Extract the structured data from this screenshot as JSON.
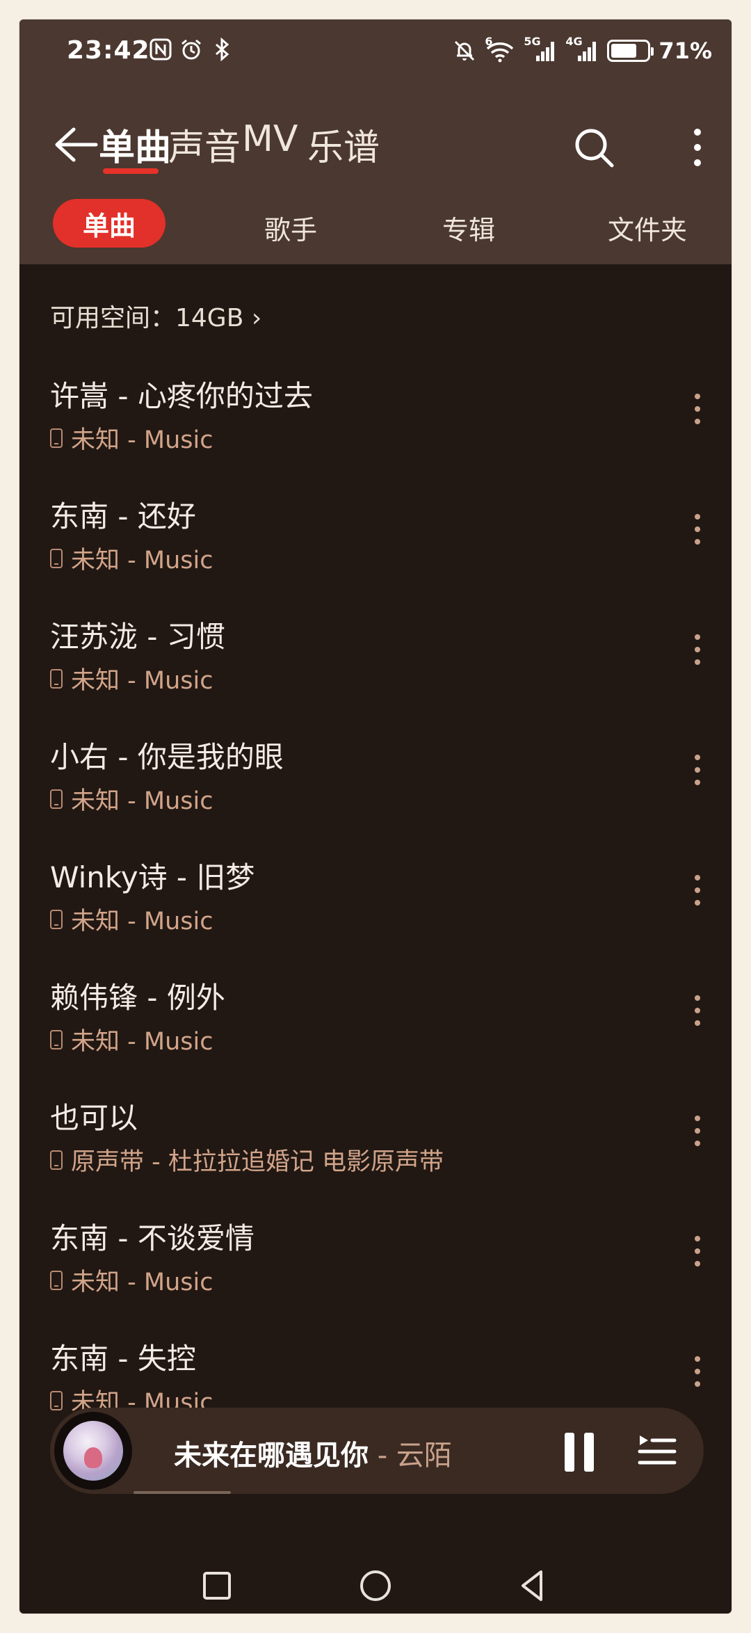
{
  "status_bar": {
    "time": "23:42",
    "battery_percent": "71%",
    "battery_level": 0.71,
    "signal_1_label": "5G",
    "signal_2_label": "4G",
    "wifi_label": "6",
    "left_icons": [
      "nfc-icon",
      "alarm-icon",
      "bluetooth-icon"
    ],
    "right_icons": [
      "mute-icon",
      "wifi-icon",
      "signal-5g-icon",
      "signal-4g-icon",
      "battery-icon"
    ]
  },
  "top_nav": {
    "back_icon": "back-arrow-icon",
    "tabs": [
      {
        "label": "单曲",
        "active": true
      },
      {
        "label": "声音",
        "active": false
      },
      {
        "label": "MV",
        "active": false
      },
      {
        "label": "乐谱",
        "active": false
      }
    ],
    "search_icon": "search-icon",
    "more_icon": "more-vertical-icon"
  },
  "sub_tabs": [
    {
      "label": "单曲",
      "active": true
    },
    {
      "label": "歌手",
      "active": false
    },
    {
      "label": "专辑",
      "active": false
    },
    {
      "label": "文件夹",
      "active": false
    }
  ],
  "storage": {
    "label": "可用空间：14GB",
    "chevron": "›"
  },
  "songs": [
    {
      "title": "许嵩 - 心疼你的过去",
      "subtitle": "未知 - Music"
    },
    {
      "title": "东南 - 还好",
      "subtitle": "未知 - Music"
    },
    {
      "title": "汪苏泷 - 习惯",
      "subtitle": "未知 - Music"
    },
    {
      "title": "小右 - 你是我的眼",
      "subtitle": "未知 - Music"
    },
    {
      "title": "Winky诗 - 旧梦",
      "subtitle": "未知 - Music"
    },
    {
      "title": "赖伟锋 - 例外",
      "subtitle": "未知 - Music"
    },
    {
      "title": "也可以",
      "subtitle": "原声带 - 杜拉拉追婚记 电影原声带"
    },
    {
      "title": "东南 - 不谈爱情",
      "subtitle": "未知 - Music"
    },
    {
      "title": "东南 - 失控",
      "subtitle": "未知 - Music"
    }
  ],
  "player": {
    "song": "未来在哪遇见你",
    "artist": " - 云陌",
    "progress": 0.2,
    "pause_icon": "pause-icon",
    "playlist_icon": "playlist-icon"
  },
  "colors": {
    "header_bg": "#4b3830",
    "list_bg": "#211813",
    "accent": "#e2302a",
    "subtitle": "#d2a48a"
  },
  "system_nav": [
    "recents-icon",
    "home-icon",
    "back-icon"
  ]
}
